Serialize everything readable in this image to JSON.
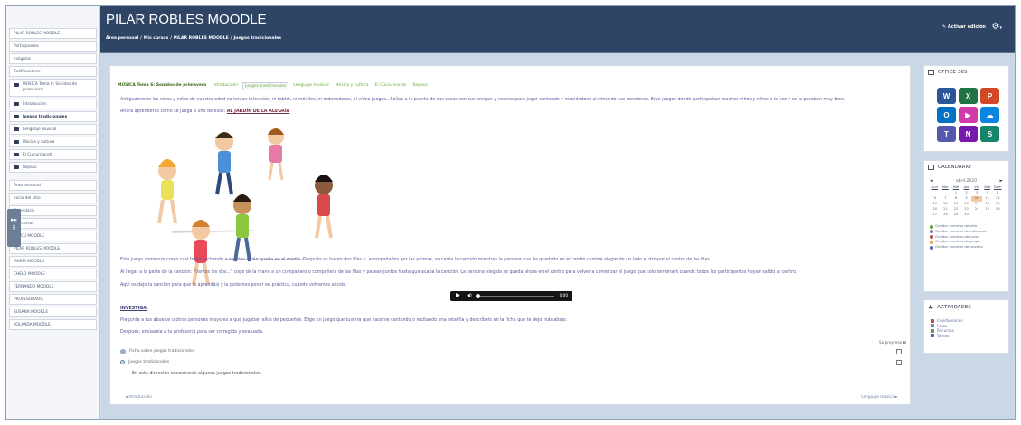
{
  "sidebar": {
    "items": [
      {
        "label": "PILAR ROBLES MOODLE"
      },
      {
        "label": "Participantes"
      },
      {
        "label": "Insignias"
      },
      {
        "label": "Calificaciones"
      },
      {
        "label": "MÚSICA Tema 6: Sonidos de primavera",
        "icon": "folder-icon"
      },
      {
        "label": "Introducción",
        "icon": "folder-icon"
      },
      {
        "label": "Juegos tradicionales",
        "icon": "folder-icon",
        "active": true
      },
      {
        "label": "Lenguaje musical",
        "icon": "folder-icon"
      },
      {
        "label": "Música y cultura",
        "icon": "folder-icon"
      },
      {
        "label": "El Cuicuricando",
        "icon": "folder-icon"
      },
      {
        "label": "Repaso",
        "icon": "folder-icon"
      }
    ],
    "lower_items": [
      {
        "label": "Área personal"
      },
      {
        "label": "Inicio del sitio"
      },
      {
        "label": "Calendario"
      },
      {
        "label": "Mis cursos"
      },
      {
        "label": "IMACU MOODLE"
      },
      {
        "label": "PILAR ROBLES MOODLE"
      },
      {
        "label": "MARÍA MOODLE"
      },
      {
        "label": "CHELO MOODLE"
      },
      {
        "label": "FERNANDO MOODLE"
      },
      {
        "label": "PROFESORADO"
      },
      {
        "label": "SUSANA MOODLE"
      },
      {
        "label": "YOLANDA MOODLE"
      }
    ],
    "drawer_toggle": "▸▸"
  },
  "header": {
    "title": "PILAR ROBLES MOODLE",
    "breadcrumb": [
      "Área personal",
      "/",
      "Mis cursos",
      "/",
      "PILAR ROBLES MOODLE",
      "/",
      "Juegos tradicionales"
    ],
    "edit_mode": "Activar edición",
    "settings_icon": "gear-icon"
  },
  "main": {
    "section_tabs": [
      {
        "label": "MÚSICA Tema 6: Sonidos de primavera",
        "kind": "first"
      },
      {
        "label": "Introducción"
      },
      {
        "label": "Juegos tradicionales",
        "kind": "active"
      },
      {
        "label": "Lenguaje musical"
      },
      {
        "label": "Música y cultura"
      },
      {
        "label": "El Cuicuricando"
      },
      {
        "label": "Repaso"
      }
    ],
    "intro_text": "Antiguamente los niños y niñas de vuestra edad no tenían televisión, ni tablet, ni móviles, ni ordenadores, ni vídeo juegos...Salían a la puerta de sus casas con sus amigos y vecinos para jugar cantando y moviéndose al ritmo de sus canciones. Eran juegos donde participaban muchos niños y niñas a la vez y se lo pasaban muy bien.",
    "learn_text": "Ahora aprenderás cómo se juega a uno de ellos:",
    "learn_link": "AL JARDÍN DE LA ALEGRÍA",
    "game_text_1": "Este juego comienza como casi todos: echando a suertes quién queda en el medio. Después se hacen dos filas y, acompañados por las palmas, se canta la canción mientras la persona que ha quedado en el centro camina alegre de un lado a otro por el centro de las filas.",
    "game_text_2": "Al llegar a la parte de la canción: \"Vamos los dos...\" coge de la mano a un compañero o compañera de las filas y pasean juntos hasta que acaba la canción. La persona elegida se queda ahora en el centro para volver a comenzar el juego que solo terminará cuando todos los participantes hayan salido al centro.",
    "game_text_3": "Aquí os dejo la canción para que lo aprendáis y la podamos poner en práctica, cuando volvamos al cole.",
    "audio": {
      "time": "0:00"
    },
    "invest_title": "INVESTIGA",
    "invest_text_1": "Pregunta a tus abuelos u otras personas mayores a qué jugaban ellos de pequeños. Elige un juego que tuviera que hacerse cantando o recitando una retahíla y descríbelo en la ficha que te dejo más abajo.",
    "invest_text_2": "Después, envíasela a tu profesor/a para ser corregida y evaluada.",
    "your_progress": "Su progreso",
    "activities": [
      {
        "label": "Ficha sobre juegos tradicionales",
        "icon": "forum-icon"
      },
      {
        "label": "Juegos tradicionales",
        "icon": "link-icon"
      }
    ],
    "link_desc": "En esta dirección encontrarás algunos juegos tradicionales.",
    "prev_link": "◄Introducción",
    "next_link": "Lenguaje musical►"
  },
  "blocks": {
    "office": {
      "title": "OFFICE 365",
      "apps": [
        {
          "letter": "W",
          "color": "#2b579a"
        },
        {
          "letter": "X",
          "color": "#217346"
        },
        {
          "letter": "P",
          "color": "#d24726"
        },
        {
          "letter": "O",
          "color": "#0072c6"
        },
        {
          "letter": "▶",
          "color": "#d13ba8"
        },
        {
          "letter": "☁",
          "color": "#0a86e0"
        },
        {
          "letter": "T",
          "color": "#5558af"
        },
        {
          "letter": "N",
          "color": "#7719aa"
        },
        {
          "letter": "S",
          "color": "#14856a"
        }
      ]
    },
    "calendar": {
      "title": "CALENDARIO",
      "month": "abril 2020",
      "prev": "◄",
      "next": "►",
      "weekdays": [
        "Lun",
        "Mar",
        "Mié",
        "Jue",
        "Vie",
        "Sáb",
        "Dom"
      ],
      "weeks": [
        [
          "",
          "",
          "1",
          "2",
          "3",
          "4",
          "5"
        ],
        [
          "6",
          "7",
          "8",
          "9",
          "10",
          "11",
          "12"
        ],
        [
          "13",
          "14",
          "15",
          "16",
          "17",
          "18",
          "19"
        ],
        [
          "20",
          "21",
          "22",
          "23",
          "24",
          "25",
          "26"
        ],
        [
          "27",
          "28",
          "29",
          "30",
          "",
          "",
          ""
        ]
      ],
      "today": "10",
      "legend": [
        {
          "label": "Ocultar eventos de sitio",
          "color": "#5aa02c"
        },
        {
          "label": "Ocultar eventos de categoría",
          "color": "#7a6aa8"
        },
        {
          "label": "Ocultar eventos de curso",
          "color": "#b94a3a"
        },
        {
          "label": "Ocultar eventos de grupo",
          "color": "#e8a040"
        },
        {
          "label": "Ocultar eventos de usuario",
          "color": "#4a6ab0"
        }
      ]
    },
    "activities": {
      "title": "ACTIVIDADES",
      "items": [
        {
          "label": "Cuestionarios",
          "color": "#c44a3a"
        },
        {
          "label": "Foros",
          "color": "#6a8ab0"
        },
        {
          "label": "Recursos",
          "color": "#5a9a4a"
        },
        {
          "label": "Tareas",
          "color": "#4a6ab0"
        }
      ]
    }
  }
}
